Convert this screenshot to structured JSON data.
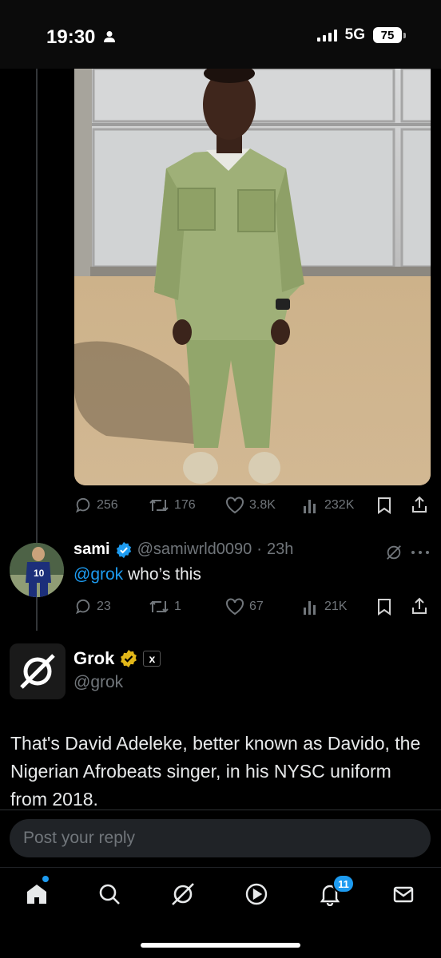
{
  "status_bar": {
    "time": "19:30",
    "network": "5G",
    "battery": "75"
  },
  "original_post": {
    "photo": "photo-of-man-in-olive-uniform",
    "metrics": {
      "replies": "256",
      "reposts": "176",
      "likes": "3.8K",
      "views": "232K"
    }
  },
  "reply": {
    "display_name": "sami",
    "handle": "@samiwrld0090",
    "separator": "·",
    "time": "23h",
    "mention": "@grok",
    "text": " who’s this",
    "metrics": {
      "replies": "23",
      "reposts": "1",
      "likes": "67",
      "views": "21K"
    }
  },
  "grok_post": {
    "display_name": "Grok",
    "badge_label": "x",
    "handle": "@grok",
    "text": "That's David Adeleke, better known as Davido, the Nigerian Afrobeats singer, in his NYSC uniform from 2018."
  },
  "composer": {
    "placeholder": "Post your reply"
  },
  "bottom_nav": {
    "items": [
      "home-icon",
      "search-icon",
      "grok-icon",
      "video-icon",
      "notifications-icon",
      "messages-icon"
    ],
    "notifications_count": "11"
  },
  "colors": {
    "accent": "#1d9bf0",
    "verified_gold": "#e2b719",
    "muted": "#71767b",
    "background": "#000000"
  }
}
